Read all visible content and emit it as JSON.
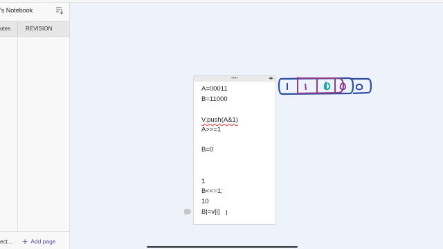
{
  "sidebar": {
    "notebook_title": "'s Notebook",
    "tabs": {
      "notes": "otes",
      "revision": "REVISION"
    },
    "bottom_left_text": "ect...",
    "add_page_label": "Add page"
  },
  "note": {
    "lines": [
      "A=00011",
      "B=11000",
      "V.push(A&1)",
      "A>>=1",
      "B=0",
      "1",
      "B<<=1;",
      "10",
      "B|=v[i]"
    ]
  },
  "colors": {
    "accent": "#5b4ea3",
    "ink_blue": "#2b4f9e",
    "ink_purple": "#8b3c8c",
    "ink_teal": "#1aa1a6"
  }
}
